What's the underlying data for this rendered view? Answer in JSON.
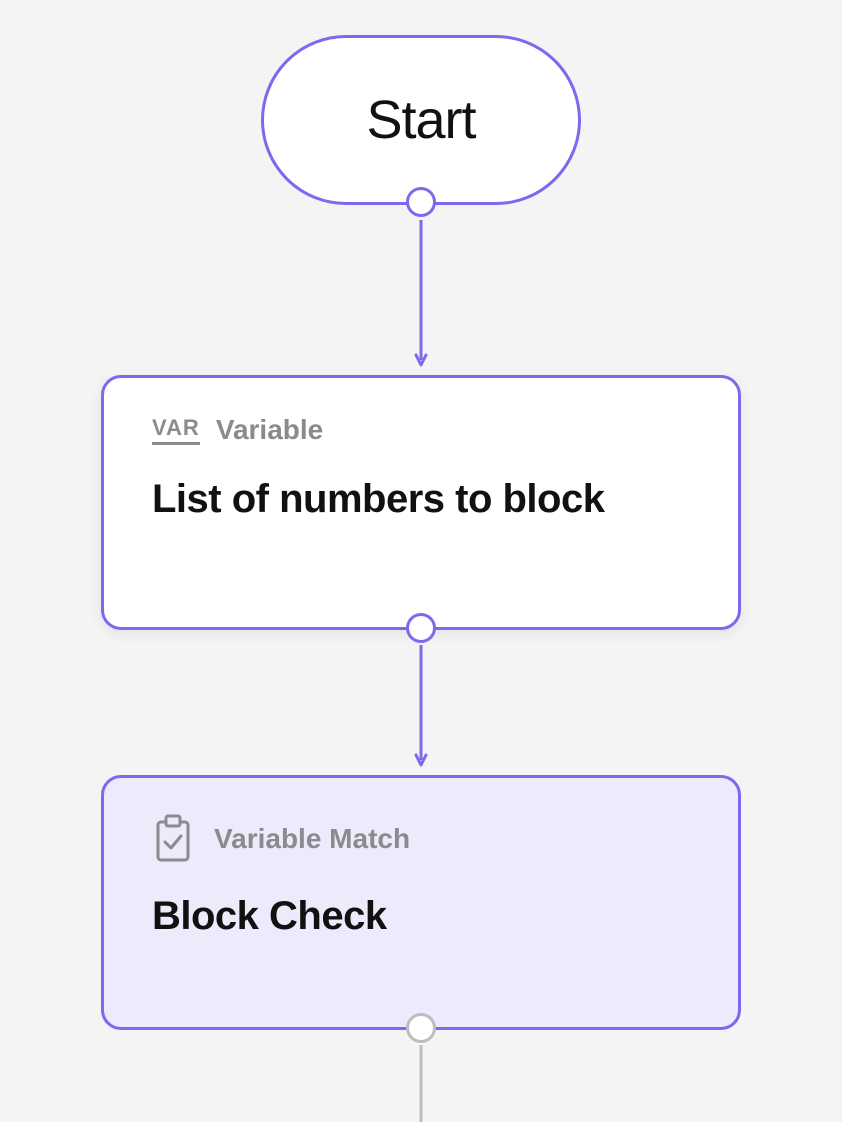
{
  "nodes": {
    "start": {
      "label": "Start"
    },
    "variable": {
      "badge": "VAR",
      "type_label": "Variable",
      "title": "List of numbers to block"
    },
    "match": {
      "type_label": "Variable Match",
      "title": "Block Check"
    }
  },
  "colors": {
    "accent": "#7c6aee",
    "muted": "#8a8a8f",
    "node_bg": "#ffffff",
    "match_bg": "#ecebfb",
    "canvas_bg": "#f4f4f5"
  }
}
